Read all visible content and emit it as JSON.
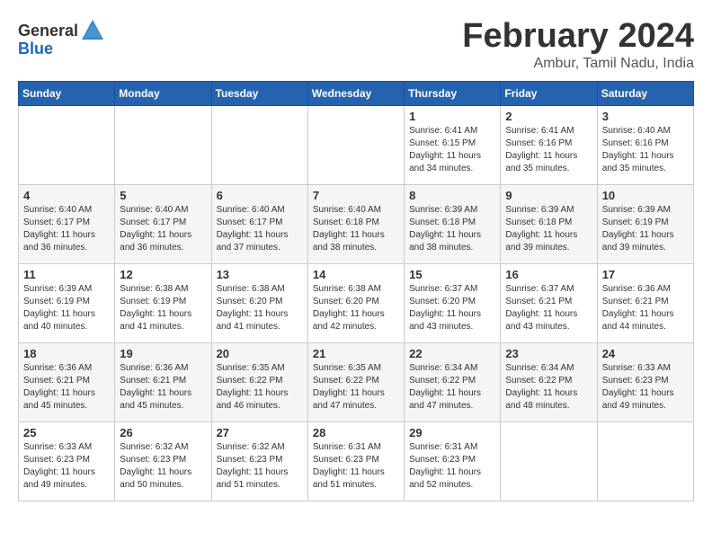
{
  "logo": {
    "general": "General",
    "blue": "Blue"
  },
  "title": "February 2024",
  "subtitle": "Ambur, Tamil Nadu, India",
  "headers": [
    "Sunday",
    "Monday",
    "Tuesday",
    "Wednesday",
    "Thursday",
    "Friday",
    "Saturday"
  ],
  "weeks": [
    [
      {
        "day": "",
        "info": ""
      },
      {
        "day": "",
        "info": ""
      },
      {
        "day": "",
        "info": ""
      },
      {
        "day": "",
        "info": ""
      },
      {
        "day": "1",
        "info": "Sunrise: 6:41 AM\nSunset: 6:15 PM\nDaylight: 11 hours\nand 34 minutes."
      },
      {
        "day": "2",
        "info": "Sunrise: 6:41 AM\nSunset: 6:16 PM\nDaylight: 11 hours\nand 35 minutes."
      },
      {
        "day": "3",
        "info": "Sunrise: 6:40 AM\nSunset: 6:16 PM\nDaylight: 11 hours\nand 35 minutes."
      }
    ],
    [
      {
        "day": "4",
        "info": "Sunrise: 6:40 AM\nSunset: 6:17 PM\nDaylight: 11 hours\nand 36 minutes."
      },
      {
        "day": "5",
        "info": "Sunrise: 6:40 AM\nSunset: 6:17 PM\nDaylight: 11 hours\nand 36 minutes."
      },
      {
        "day": "6",
        "info": "Sunrise: 6:40 AM\nSunset: 6:17 PM\nDaylight: 11 hours\nand 37 minutes."
      },
      {
        "day": "7",
        "info": "Sunrise: 6:40 AM\nSunset: 6:18 PM\nDaylight: 11 hours\nand 38 minutes."
      },
      {
        "day": "8",
        "info": "Sunrise: 6:39 AM\nSunset: 6:18 PM\nDaylight: 11 hours\nand 38 minutes."
      },
      {
        "day": "9",
        "info": "Sunrise: 6:39 AM\nSunset: 6:18 PM\nDaylight: 11 hours\nand 39 minutes."
      },
      {
        "day": "10",
        "info": "Sunrise: 6:39 AM\nSunset: 6:19 PM\nDaylight: 11 hours\nand 39 minutes."
      }
    ],
    [
      {
        "day": "11",
        "info": "Sunrise: 6:39 AM\nSunset: 6:19 PM\nDaylight: 11 hours\nand 40 minutes."
      },
      {
        "day": "12",
        "info": "Sunrise: 6:38 AM\nSunset: 6:19 PM\nDaylight: 11 hours\nand 41 minutes."
      },
      {
        "day": "13",
        "info": "Sunrise: 6:38 AM\nSunset: 6:20 PM\nDaylight: 11 hours\nand 41 minutes."
      },
      {
        "day": "14",
        "info": "Sunrise: 6:38 AM\nSunset: 6:20 PM\nDaylight: 11 hours\nand 42 minutes."
      },
      {
        "day": "15",
        "info": "Sunrise: 6:37 AM\nSunset: 6:20 PM\nDaylight: 11 hours\nand 43 minutes."
      },
      {
        "day": "16",
        "info": "Sunrise: 6:37 AM\nSunset: 6:21 PM\nDaylight: 11 hours\nand 43 minutes."
      },
      {
        "day": "17",
        "info": "Sunrise: 6:36 AM\nSunset: 6:21 PM\nDaylight: 11 hours\nand 44 minutes."
      }
    ],
    [
      {
        "day": "18",
        "info": "Sunrise: 6:36 AM\nSunset: 6:21 PM\nDaylight: 11 hours\nand 45 minutes."
      },
      {
        "day": "19",
        "info": "Sunrise: 6:36 AM\nSunset: 6:21 PM\nDaylight: 11 hours\nand 45 minutes."
      },
      {
        "day": "20",
        "info": "Sunrise: 6:35 AM\nSunset: 6:22 PM\nDaylight: 11 hours\nand 46 minutes."
      },
      {
        "day": "21",
        "info": "Sunrise: 6:35 AM\nSunset: 6:22 PM\nDaylight: 11 hours\nand 47 minutes."
      },
      {
        "day": "22",
        "info": "Sunrise: 6:34 AM\nSunset: 6:22 PM\nDaylight: 11 hours\nand 47 minutes."
      },
      {
        "day": "23",
        "info": "Sunrise: 6:34 AM\nSunset: 6:22 PM\nDaylight: 11 hours\nand 48 minutes."
      },
      {
        "day": "24",
        "info": "Sunrise: 6:33 AM\nSunset: 6:23 PM\nDaylight: 11 hours\nand 49 minutes."
      }
    ],
    [
      {
        "day": "25",
        "info": "Sunrise: 6:33 AM\nSunset: 6:23 PM\nDaylight: 11 hours\nand 49 minutes."
      },
      {
        "day": "26",
        "info": "Sunrise: 6:32 AM\nSunset: 6:23 PM\nDaylight: 11 hours\nand 50 minutes."
      },
      {
        "day": "27",
        "info": "Sunrise: 6:32 AM\nSunset: 6:23 PM\nDaylight: 11 hours\nand 51 minutes."
      },
      {
        "day": "28",
        "info": "Sunrise: 6:31 AM\nSunset: 6:23 PM\nDaylight: 11 hours\nand 51 minutes."
      },
      {
        "day": "29",
        "info": "Sunrise: 6:31 AM\nSunset: 6:23 PM\nDaylight: 11 hours\nand 52 minutes."
      },
      {
        "day": "",
        "info": ""
      },
      {
        "day": "",
        "info": ""
      }
    ]
  ]
}
